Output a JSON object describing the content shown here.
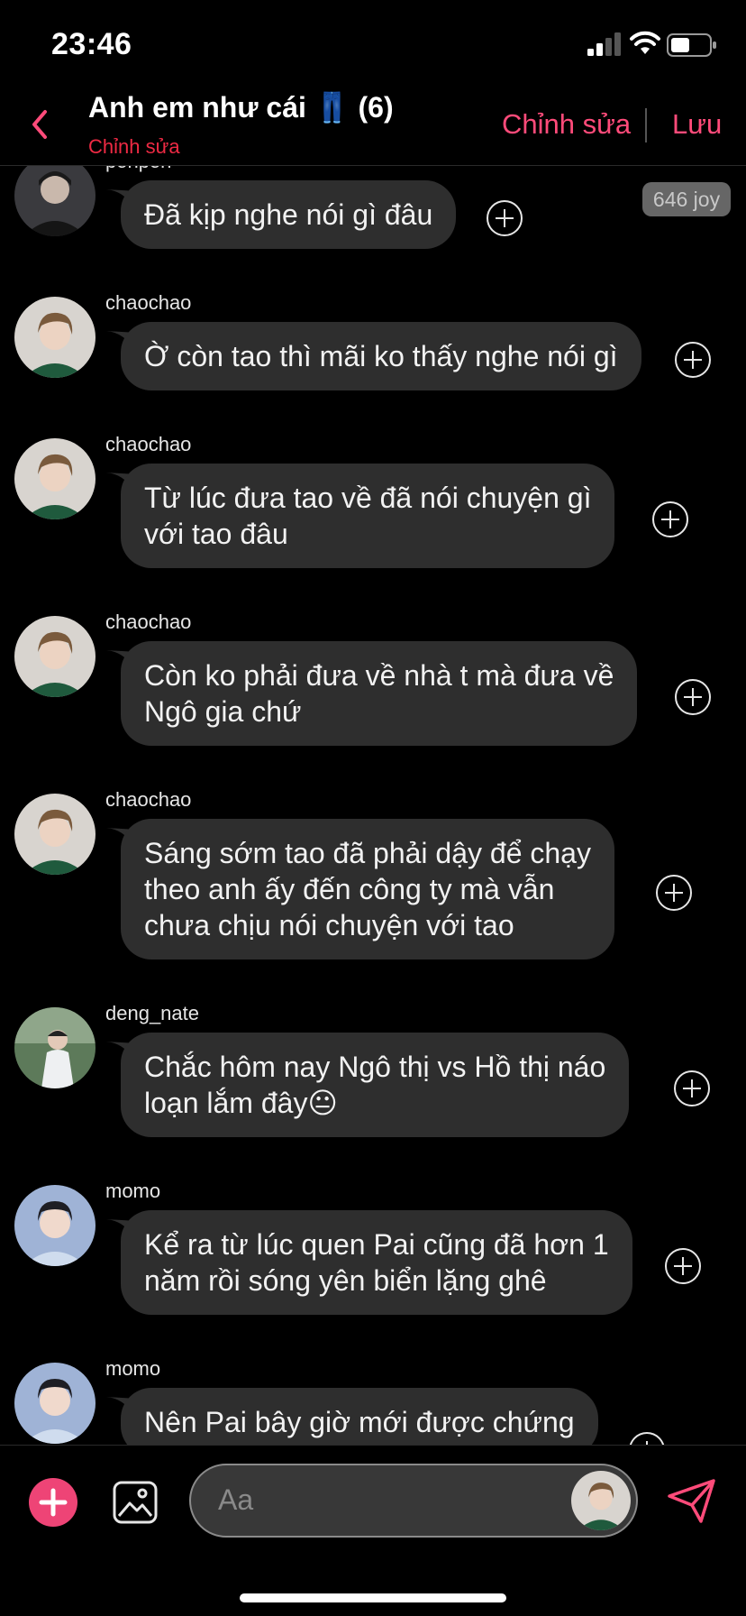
{
  "status_bar": {
    "time": "23:46"
  },
  "header": {
    "title": "Anh em như cái 👖 (6)",
    "subtitle": "Chỉnh sửa",
    "edit_label": "Chỉnh sửa",
    "save_label": "Lưu"
  },
  "joy_badge": "646 joy",
  "messages": [
    {
      "sender": "ponpon",
      "text": "Đã kịp nghe nói gì đâu",
      "avatar": "dark"
    },
    {
      "sender": "chaochao",
      "text": "Ờ còn tao thì mãi ko thấy nghe nói gì",
      "avatar": "green"
    },
    {
      "sender": "chaochao",
      "text": "Từ lúc đưa tao về đã nói chuyện gì\nvới tao đâu",
      "avatar": "green"
    },
    {
      "sender": "chaochao",
      "text": "Còn ko phải đưa về nhà t mà đưa về\nNgô gia chứ",
      "avatar": "green"
    },
    {
      "sender": "chaochao",
      "text": "Sáng sớm tao đã phải dậy để chạy\ntheo anh ấy đến công ty mà vẫn\nchưa chịu nói chuyện với tao",
      "avatar": "green"
    },
    {
      "sender": "deng_nate",
      "text": "Chắc hôm nay Ngô thị vs Hồ thị náo\nloạn lắm đây😐",
      "avatar": "outdoor"
    },
    {
      "sender": "momo",
      "text": "Kể ra từ lúc quen Pai cũng đã hơn 1\nnăm rồi sóng yên biển lặng ghê",
      "avatar": "blue"
    },
    {
      "sender": "momo",
      "text": "Nên Pai bây giờ mới được chứng",
      "avatar": "blue"
    }
  ],
  "input": {
    "placeholder": "Aa"
  },
  "icons": {
    "back": "chevron-left-icon",
    "react": "plus-circle-icon",
    "add": "plus-icon",
    "image": "image-icon",
    "send": "paper-plane-icon"
  },
  "colors": {
    "accent": "#ff4b7a",
    "subtitle": "#ee2a44",
    "bubble": "#2e2e2e",
    "add_button": "#ee4476"
  }
}
